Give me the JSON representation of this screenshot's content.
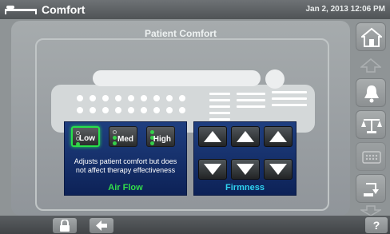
{
  "header": {
    "title": "Comfort",
    "datetime": "Jan 2, 2013 12:06 PM"
  },
  "main": {
    "section_title": "Patient Comfort",
    "air_flow": {
      "label": "Air Flow",
      "description_line1": "Adjusts patient comfort  but does",
      "description_line2": "not affect therapy effectiveness",
      "selected": "Low",
      "options": [
        {
          "label": "Low",
          "level": 1
        },
        {
          "label": "Med",
          "level": 2
        },
        {
          "label": "High",
          "level": 3
        }
      ]
    },
    "firmness": {
      "label": "Firmness"
    }
  },
  "sidebar": {
    "items": [
      {
        "icon": "home-icon"
      },
      {
        "icon": "up-arrow-icon"
      },
      {
        "icon": "bell-icon"
      },
      {
        "icon": "scale-icon"
      },
      {
        "icon": "mattress-heat-icon"
      },
      {
        "icon": "transfer-icon"
      }
    ]
  },
  "footer": {
    "help_label": "?"
  },
  "colors": {
    "accent_green": "#32dc4b",
    "firmness_cyan": "#2fd2f0",
    "panel_blue": "#1f3f80"
  }
}
